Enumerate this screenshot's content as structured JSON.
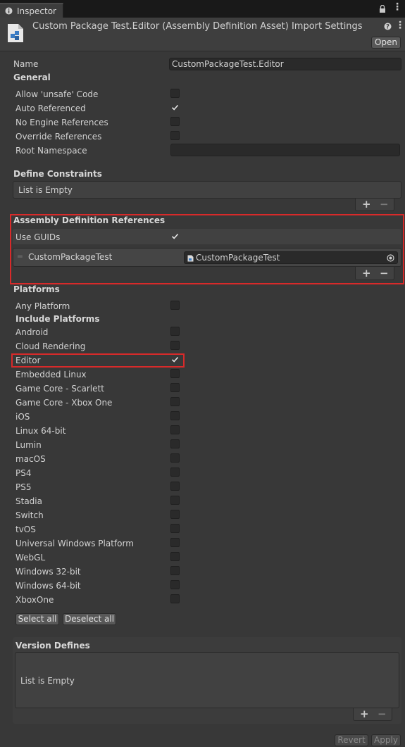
{
  "tab": {
    "icon": "info-icon",
    "label": "Inspector"
  },
  "header": {
    "icon": "assembly-definition-icon",
    "title": "Custom Package Test.Editor (Assembly Definition Asset) Import Settings",
    "open_label": "Open"
  },
  "name": {
    "label": "Name",
    "value": "CustomPackageTest.Editor"
  },
  "general": {
    "heading": "General",
    "items": [
      {
        "label": "Allow 'unsafe' Code",
        "checked": false
      },
      {
        "label": "Auto Referenced",
        "checked": true
      },
      {
        "label": "No Engine References",
        "checked": false
      },
      {
        "label": "Override References",
        "checked": false
      }
    ],
    "root_namespace_label": "Root Namespace",
    "root_namespace_value": ""
  },
  "define_constraints": {
    "heading": "Define Constraints",
    "empty_text": "List is Empty"
  },
  "assembly_refs": {
    "heading": "Assembly Definition References",
    "use_guids_label": "Use GUIDs",
    "use_guids_checked": true,
    "entry_label": "CustomPackageTest",
    "entry_value": "CustomPackageTest"
  },
  "platforms": {
    "heading": "Platforms",
    "any_platform_label": "Any Platform",
    "include_heading": "Include Platforms",
    "items": [
      {
        "label": "Android",
        "checked": false
      },
      {
        "label": "Cloud Rendering",
        "checked": false
      },
      {
        "label": "Editor",
        "checked": true
      },
      {
        "label": "Embedded Linux",
        "checked": false
      },
      {
        "label": "Game Core - Scarlett",
        "checked": false
      },
      {
        "label": "Game Core - Xbox One",
        "checked": false
      },
      {
        "label": "iOS",
        "checked": false
      },
      {
        "label": "Linux 64-bit",
        "checked": false
      },
      {
        "label": "Lumin",
        "checked": false
      },
      {
        "label": "macOS",
        "checked": false
      },
      {
        "label": "PS4",
        "checked": false
      },
      {
        "label": "PS5",
        "checked": false
      },
      {
        "label": "Stadia",
        "checked": false
      },
      {
        "label": "Switch",
        "checked": false
      },
      {
        "label": "tvOS",
        "checked": false
      },
      {
        "label": "Universal Windows Platform",
        "checked": false
      },
      {
        "label": "WebGL",
        "checked": false
      },
      {
        "label": "Windows 32-bit",
        "checked": false
      },
      {
        "label": "Windows 64-bit",
        "checked": false
      },
      {
        "label": "XboxOne",
        "checked": false
      }
    ],
    "select_all_label": "Select all",
    "deselect_all_label": "Deselect all"
  },
  "version_defines": {
    "heading": "Version Defines",
    "empty_text": "List is Empty"
  },
  "list_controls": {
    "add_symbol": "+",
    "remove_symbol": "−"
  },
  "footer": {
    "revert_label": "Revert",
    "apply_label": "Apply"
  },
  "colors": {
    "highlight": "#d82a2a",
    "background": "#383838"
  }
}
